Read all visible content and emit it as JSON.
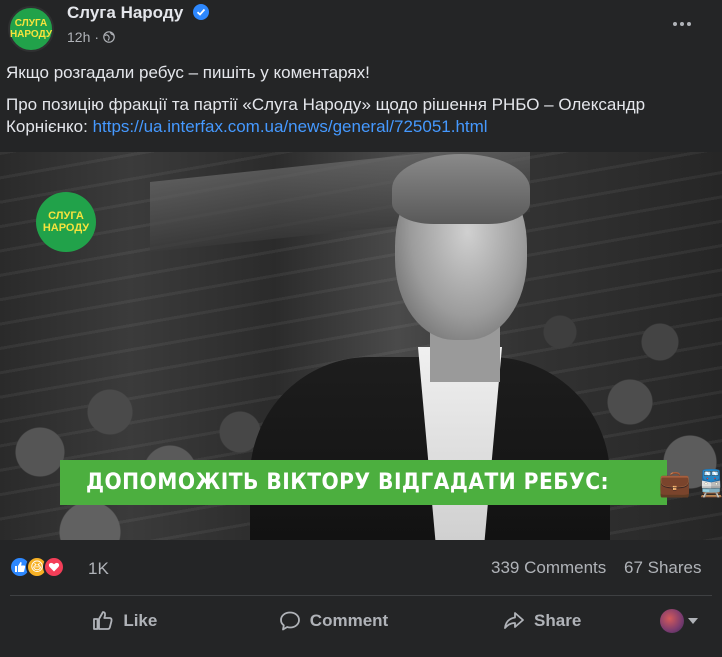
{
  "post": {
    "page_name": "Слуга Народу",
    "verified_icon": "verified-badge-icon",
    "timestamp": "12h",
    "separator": "·",
    "privacy_icon": "globe-icon",
    "avatar_line1": "СЛУГА",
    "avatar_line2": "НАРОДУ",
    "text_line1": "Якщо розгадали ребус – пишіть у коментарях!",
    "text_line2": "Про позицію фракції та партії «Слуга Народу» щодо рішення РНБО – Олександр Корнієнко: ",
    "link": "https://ua.interfax.com.ua/news/general/725051.html"
  },
  "image": {
    "logo_line1": "СЛУГА",
    "logo_line2": "НАРОДУ",
    "banner_text": "ДОПОМОЖІТЬ ВІКТОРУ ВІДГАДАТИ РЕБУС:",
    "banner_emoji_1": "💼",
    "banner_emoji_2": "🚆",
    "banner_dots": "..."
  },
  "stats": {
    "reactions": [
      "like",
      "haha",
      "love"
    ],
    "reaction_count": "1K",
    "comments": "339 Comments",
    "shares": "67 Shares"
  },
  "actions": {
    "like": "Like",
    "comment": "Comment",
    "share": "Share"
  },
  "colors": {
    "background": "#242526",
    "text": "#e4e6eb",
    "secondary": "#b0b3b8",
    "link": "#4599ff",
    "brand_green": "#21a24a",
    "banner_green": "#4caf3f"
  }
}
